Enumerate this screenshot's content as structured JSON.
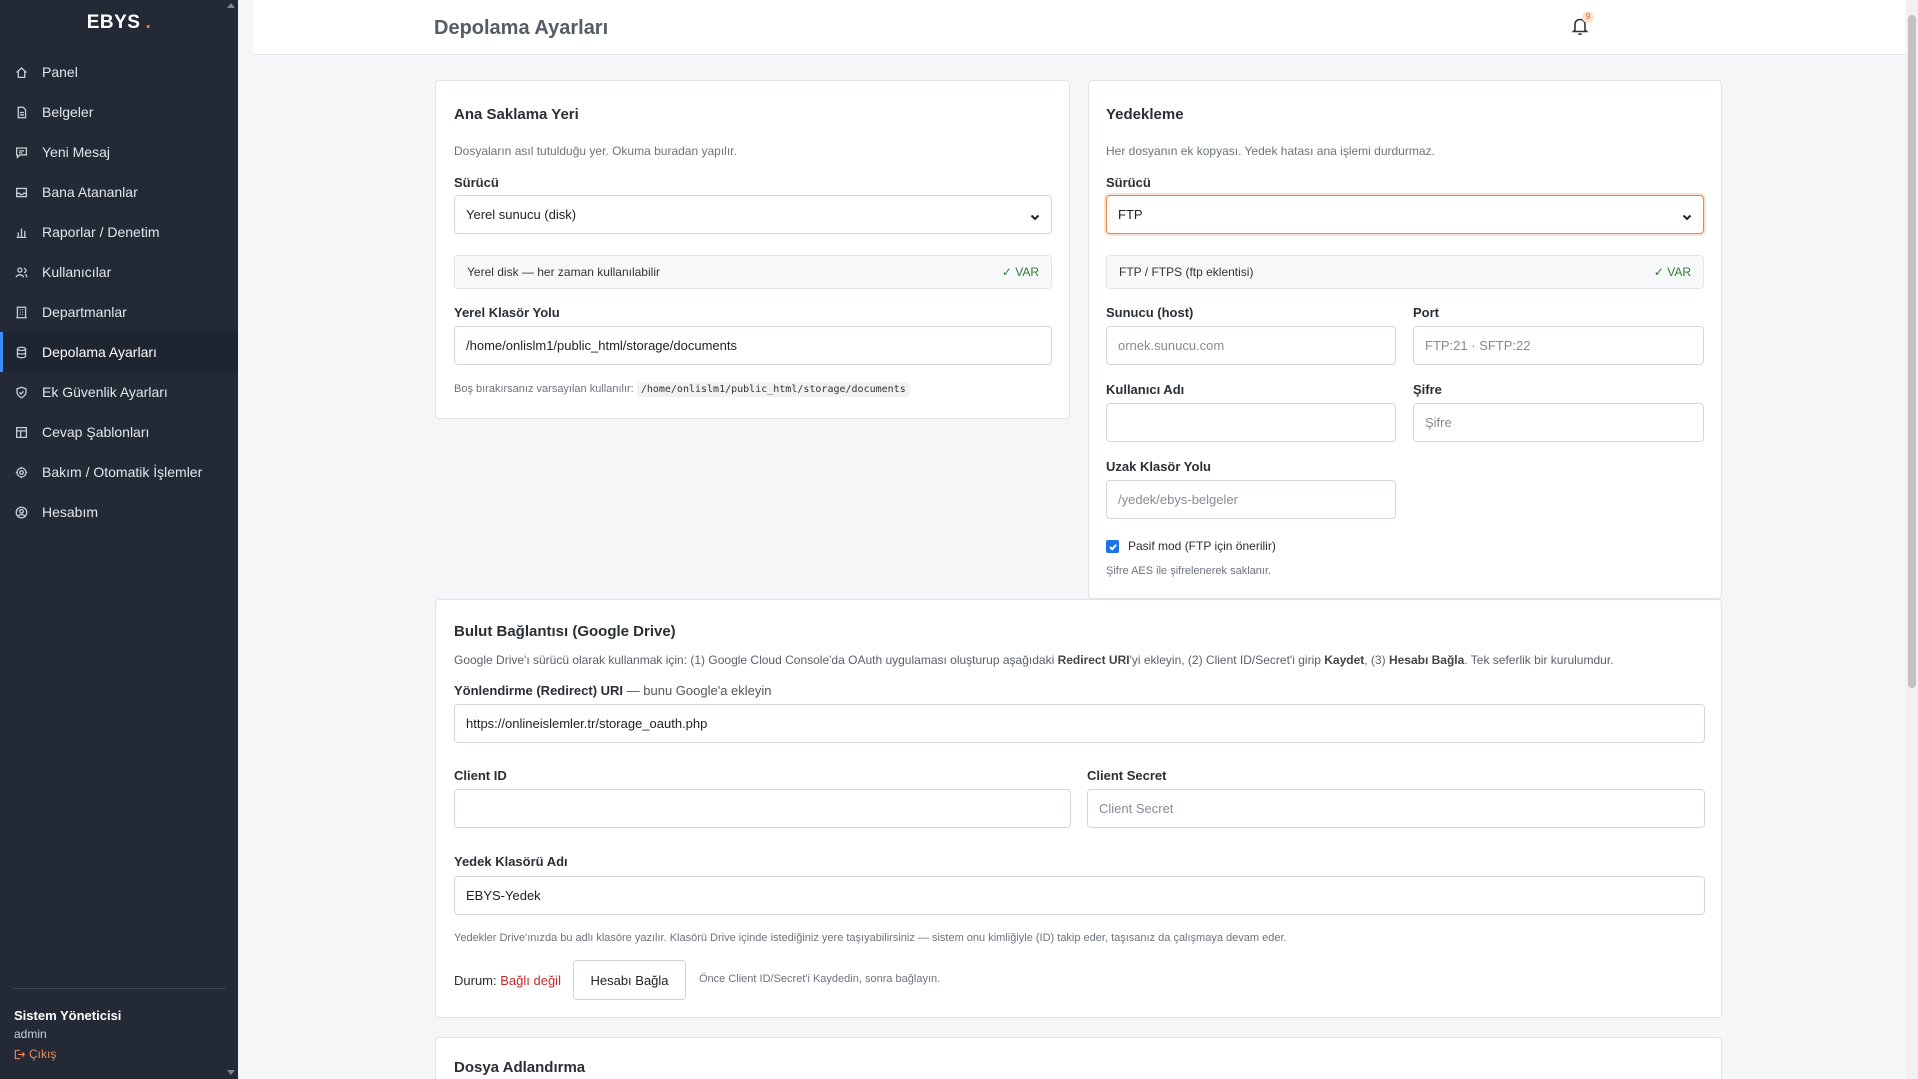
{
  "app": {
    "brand": "EBYS",
    "brand_dot": "."
  },
  "sidebar": {
    "items": [
      {
        "label": "Panel",
        "icon": "home-icon",
        "active": false
      },
      {
        "label": "Belgeler",
        "icon": "document-icon",
        "active": false
      },
      {
        "label": "Yeni Mesaj",
        "icon": "message-icon",
        "active": false
      },
      {
        "label": "Bana Atananlar",
        "icon": "inbox-icon",
        "active": false
      },
      {
        "label": "Raporlar / Denetim",
        "icon": "bar-chart-icon",
        "active": false
      },
      {
        "label": "Kullanıcılar",
        "icon": "users-icon",
        "active": false
      },
      {
        "label": "Departmanlar",
        "icon": "building-icon",
        "active": false
      },
      {
        "label": "Depolama Ayarları",
        "icon": "database-icon",
        "active": true
      },
      {
        "label": "Ek Güvenlik Ayarları",
        "icon": "shield-icon",
        "active": false
      },
      {
        "label": "Cevap Şablonları",
        "icon": "template-icon",
        "active": false
      },
      {
        "label": "Bakım / Otomatik İşlemler",
        "icon": "gear-icon",
        "active": false
      },
      {
        "label": "Hesabım",
        "icon": "user-circle-icon",
        "active": false
      }
    ],
    "user": {
      "name": "Sistem Yöneticisi",
      "role": "admin",
      "logout": "Çıkış"
    }
  },
  "header": {
    "title": "Depolama Ayarları",
    "notification_count": "9"
  },
  "primary_storage": {
    "title": "Ana Saklama Yeri",
    "description": "Dosyaların asıl tutulduğu yer. Okuma buradan yapılır.",
    "driver_label": "Sürücü",
    "driver_value": "Yerel sunucu (disk)",
    "status_text": "Yerel disk — her zaman kullanılabilir",
    "status_badge": "✓ VAR",
    "path_label": "Yerel Klasör Yolu",
    "path_value": "/home/onlislm1/public_html/storage/documents",
    "hint_prefix": "Boş bırakırsanız varsayılan kullanılır:",
    "hint_code": "/home/onlislm1/public_html/storage/documents"
  },
  "backup": {
    "title": "Yedekleme",
    "description": "Her dosyanın ek kopyası. Yedek hatası ana işlemi durdurmaz.",
    "driver_label": "Sürücü",
    "driver_value": "FTP",
    "status_text": "FTP / FTPS (ftp eklentisi)",
    "status_badge": "✓ VAR",
    "host_label": "Sunucu (host)",
    "host_placeholder": "ornek.sunucu.com",
    "port_label": "Port",
    "port_placeholder": "FTP:21 · SFTP:22",
    "username_label": "Kullanıcı Adı",
    "username_value": "",
    "password_label": "Şifre",
    "password_placeholder": "Şifre",
    "remote_path_label": "Uzak Klasör Yolu",
    "remote_path_placeholder": "/yedek/ebys-belgeler",
    "passive_label": "Pasif mod (FTP için önerilir)",
    "passive_checked": true,
    "encryption_note": "Şifre AES ile şifrelenerek saklanır."
  },
  "cloud": {
    "title": "Bulut Bağlantısı (Google Drive)",
    "instructions": {
      "p1": "Google Drive'ı sürücü olarak kullanmak için: (1) Google Cloud Console'da OAuth uygulaması oluşturup aşağıdaki ",
      "b1": "Redirect URI",
      "p2": "'yi ekleyin, (2) Client ID/Secret'i girip ",
      "b2": "Kaydet",
      "p3": ", (3) ",
      "b3": "Hesabı Bağla",
      "p4": ". Tek seferlik bir kurulumdur."
    },
    "redirect_label": "Yönlendirme (Redirect) URI",
    "redirect_label_suffix": " — bunu Google'a ekleyin",
    "redirect_value": "https://onlineislemler.tr/storage_oauth.php",
    "client_id_label": "Client ID",
    "client_id_value": "",
    "client_secret_label": "Client Secret",
    "client_secret_placeholder": "Client Secret",
    "folder_label": "Yedek Klasörü Adı",
    "folder_value": "EBYS-Yedek",
    "folder_note": "Yedekler Drive'ınızda bu adlı klasöre yazılır. Klasörü Drive içinde istediğiniz yere taşıyabilirsiniz — sistem onu kimliğiyle (ID) takip eder, taşısanız da çalışmaya devam eder.",
    "status_label": "Durum:",
    "status_value": "Bağlı değil",
    "connect_button": "Hesabı Bağla",
    "connect_note": "Önce Client ID/Secret'i Kaydedin, sonra bağlayın."
  },
  "naming": {
    "title": "Dosya Adlandırma"
  },
  "colors": {
    "sidebar_bg": "#232a35",
    "accent": "#f07d2e",
    "ok": "#2e7d32",
    "error": "#c62828"
  }
}
